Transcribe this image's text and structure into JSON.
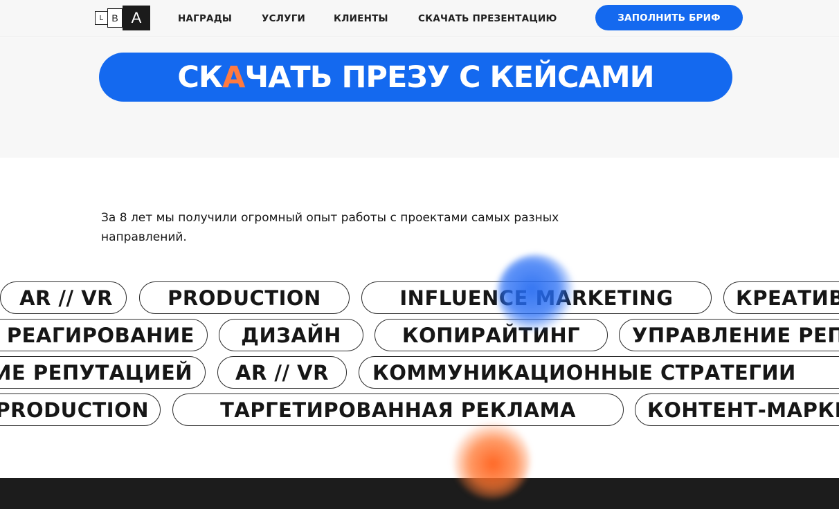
{
  "header": {
    "logo": {
      "letter_1": "L",
      "letter_2": "B",
      "letter_3": "A"
    },
    "nav": [
      "НАГРАДЫ",
      "УСЛУГИ",
      "КЛИЕНТЫ",
      "СКАЧАТЬ ПРЕЗЕНТАЦИЮ"
    ],
    "brief_button": "ЗАПОЛНИТЬ БРИФ"
  },
  "hero": {
    "cta_part_1": "СК",
    "cta_highlight": "А",
    "cta_part_2": "ЧАТЬ ПРЕЗУ С КЕЙСАМИ"
  },
  "intro": {
    "text": "За 8 лет мы получили огромный опыт работы с проектами самых разных направлений."
  },
  "tags": [
    [
      "AR // VR",
      "PRODUCTION",
      "INFLUENCE MARKETING",
      "КРЕАТИВ"
    ],
    [
      "РЕАГИРОВАНИЕ",
      "ДИЗАЙН",
      "КОПИРАЙТИНГ",
      "УПРАВЛЕНИЕ РЕПУТАЦИЕЙ"
    ],
    [
      "УПРАВЛЕНИЕ РЕПУТАЦИЕЙ",
      "AR // VR",
      "КОММУНИКАЦИОННЫЕ СТРАТЕГИИ"
    ],
    [
      "PRODUCTION",
      "ТАРГЕТИРОВАННАЯ РЕКЛАМА",
      "КОНТЕНТ-МАРКЕТИНГ"
    ]
  ],
  "colors": {
    "accent_blue": "#1469ef",
    "accent_orange": "#ff7a40",
    "dark": "#1c1c1c"
  }
}
